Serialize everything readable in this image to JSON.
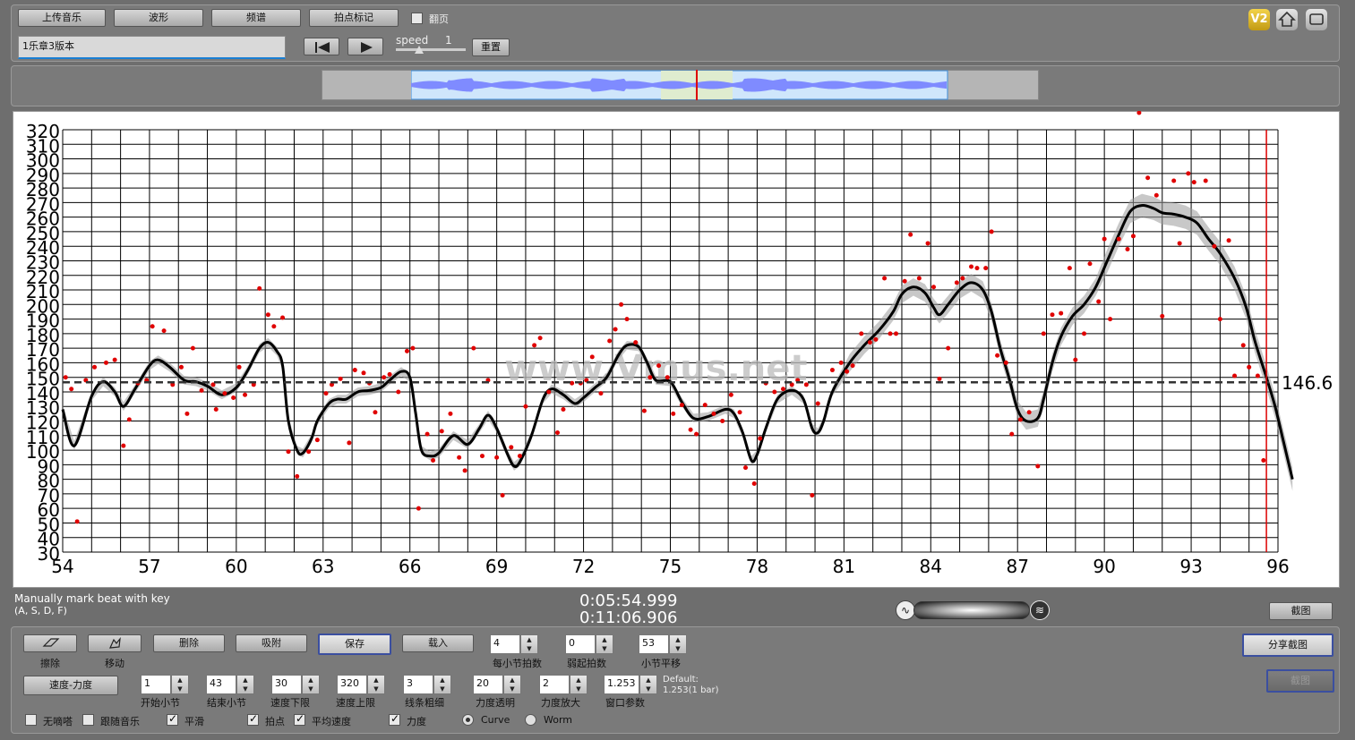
{
  "toolbar": {
    "upload": "上传音乐",
    "waveform": "波形",
    "spectrum": "频谱",
    "beat_mark": "拍点标记",
    "flip_page": "翻页",
    "speed_label": "speed",
    "speed_value": "1",
    "reset": "重置",
    "file_value": "1乐章3版本"
  },
  "top_right": {
    "badge": "V2"
  },
  "chart_data": {
    "type": "line",
    "x_ticks": [
      54,
      57,
      60,
      63,
      66,
      69,
      72,
      75,
      78,
      81,
      84,
      87,
      90,
      93,
      96
    ],
    "y_ticks": [
      30,
      40,
      50,
      60,
      70,
      80,
      90,
      100,
      110,
      120,
      130,
      140,
      150,
      160,
      170,
      180,
      190,
      200,
      210,
      220,
      230,
      240,
      250,
      260,
      270,
      280,
      290,
      300,
      310,
      320
    ],
    "xlim": [
      54,
      96
    ],
    "ylim": [
      30,
      320
    ],
    "average_value": 146.6,
    "average_label": "146.6",
    "playhead_x": 95.6,
    "watermark": "www.Vmus.net",
    "curve": [
      [
        54,
        128
      ],
      [
        54.4,
        103
      ],
      [
        55,
        137
      ],
      [
        55.4,
        147
      ],
      [
        55.8,
        140
      ],
      [
        56.1,
        130
      ],
      [
        56.5,
        142
      ],
      [
        57,
        158
      ],
      [
        57.3,
        162
      ],
      [
        57.7,
        157
      ],
      [
        58.2,
        148
      ],
      [
        58.6,
        147
      ],
      [
        59,
        144
      ],
      [
        59.5,
        138
      ],
      [
        60,
        143
      ],
      [
        60.4,
        155
      ],
      [
        60.8,
        170
      ],
      [
        61.1,
        174
      ],
      [
        61.4,
        168
      ],
      [
        61.6,
        158
      ],
      [
        61.8,
        120
      ],
      [
        62.1,
        100
      ],
      [
        62.3,
        98
      ],
      [
        62.6,
        108
      ],
      [
        62.8,
        120
      ],
      [
        63.2,
        132
      ],
      [
        63.5,
        135
      ],
      [
        63.8,
        135
      ],
      [
        64.2,
        140
      ],
      [
        64.6,
        141
      ],
      [
        65,
        143
      ],
      [
        65.3,
        148
      ],
      [
        65.7,
        154
      ],
      [
        66,
        150
      ],
      [
        66.2,
        125
      ],
      [
        66.4,
        100
      ],
      [
        66.7,
        96
      ],
      [
        67,
        98
      ],
      [
        67.5,
        110
      ],
      [
        68,
        104
      ],
      [
        68.4,
        115
      ],
      [
        68.7,
        124
      ],
      [
        69,
        115
      ],
      [
        69.4,
        96
      ],
      [
        69.6,
        89
      ],
      [
        69.8,
        92
      ],
      [
        70.2,
        110
      ],
      [
        70.6,
        135
      ],
      [
        70.9,
        142
      ],
      [
        71.3,
        138
      ],
      [
        71.7,
        132
      ],
      [
        72,
        136
      ],
      [
        72.4,
        143
      ],
      [
        72.8,
        150
      ],
      [
        73.2,
        165
      ],
      [
        73.5,
        172
      ],
      [
        73.9,
        171
      ],
      [
        74.2,
        160
      ],
      [
        74.5,
        148
      ],
      [
        75,
        147
      ],
      [
        75.4,
        133
      ],
      [
        75.8,
        122
      ],
      [
        76.3,
        123
      ],
      [
        76.9,
        128
      ],
      [
        77.2,
        125
      ],
      [
        77.5,
        112
      ],
      [
        77.8,
        93
      ],
      [
        78,
        97
      ],
      [
        78.3,
        115
      ],
      [
        78.7,
        135
      ],
      [
        79.2,
        141
      ],
      [
        79.6,
        135
      ],
      [
        79.9,
        115
      ],
      [
        80.1,
        112
      ],
      [
        80.3,
        120
      ],
      [
        80.6,
        140
      ],
      [
        81.2,
        160
      ],
      [
        81.7,
        172
      ],
      [
        82.2,
        182
      ],
      [
        82.7,
        195
      ],
      [
        83,
        207
      ],
      [
        83.4,
        212
      ],
      [
        83.8,
        208
      ],
      [
        84.1,
        198
      ],
      [
        84.3,
        193
      ],
      [
        84.6,
        200
      ],
      [
        85,
        210
      ],
      [
        85.4,
        215
      ],
      [
        85.8,
        210
      ],
      [
        86.1,
        195
      ],
      [
        86.4,
        170
      ],
      [
        86.7,
        150
      ],
      [
        87,
        128
      ],
      [
        87.3,
        120
      ],
      [
        87.7,
        122
      ],
      [
        87.9,
        135
      ],
      [
        88.2,
        160
      ],
      [
        88.5,
        178
      ],
      [
        88.9,
        192
      ],
      [
        89.3,
        200
      ],
      [
        89.7,
        212
      ],
      [
        90.1,
        230
      ],
      [
        90.5,
        248
      ],
      [
        90.9,
        264
      ],
      [
        91.3,
        268
      ],
      [
        91.7,
        266
      ],
      [
        92,
        263
      ],
      [
        92.4,
        262
      ],
      [
        92.8,
        260
      ],
      [
        93.2,
        256
      ],
      [
        93.6,
        245
      ],
      [
        94,
        235
      ],
      [
        94.5,
        218
      ],
      [
        94.9,
        198
      ],
      [
        95.2,
        175
      ],
      [
        95.6,
        150
      ],
      [
        95.9,
        130
      ],
      [
        96.2,
        105
      ],
      [
        96.5,
        80
      ]
    ],
    "points": [
      [
        54.1,
        150
      ],
      [
        54.3,
        142
      ],
      [
        54.5,
        51
      ],
      [
        54.8,
        148
      ],
      [
        55.1,
        157
      ],
      [
        55.5,
        160
      ],
      [
        55.8,
        162
      ],
      [
        56.1,
        103
      ],
      [
        56.3,
        121
      ],
      [
        56.6,
        146
      ],
      [
        56.9,
        148
      ],
      [
        57.1,
        185
      ],
      [
        57.5,
        182
      ],
      [
        57.8,
        145
      ],
      [
        58.1,
        157
      ],
      [
        58.3,
        125
      ],
      [
        58.5,
        170
      ],
      [
        58.8,
        141
      ],
      [
        59.2,
        145
      ],
      [
        59.3,
        128
      ],
      [
        59.6,
        139
      ],
      [
        59.9,
        136
      ],
      [
        60.1,
        157
      ],
      [
        60.3,
        138
      ],
      [
        60.6,
        145
      ],
      [
        60.8,
        211
      ],
      [
        61.1,
        193
      ],
      [
        61.3,
        185
      ],
      [
        61.6,
        191
      ],
      [
        61.8,
        99
      ],
      [
        62.1,
        82
      ],
      [
        62.5,
        99
      ],
      [
        62.8,
        107
      ],
      [
        63.1,
        139
      ],
      [
        63.3,
        145
      ],
      [
        63.6,
        149
      ],
      [
        63.9,
        105
      ],
      [
        64.1,
        155
      ],
      [
        64.4,
        153
      ],
      [
        64.6,
        146
      ],
      [
        64.8,
        126
      ],
      [
        65.1,
        150
      ],
      [
        65.3,
        152
      ],
      [
        65.6,
        140
      ],
      [
        65.9,
        168
      ],
      [
        66.1,
        170
      ],
      [
        66.3,
        60
      ],
      [
        66.6,
        111
      ],
      [
        66.8,
        93
      ],
      [
        67.1,
        113
      ],
      [
        67.4,
        125
      ],
      [
        67.7,
        95
      ],
      [
        67.9,
        86
      ],
      [
        68.2,
        170
      ],
      [
        68.5,
        96
      ],
      [
        68.7,
        148
      ],
      [
        69,
        95
      ],
      [
        69.2,
        69
      ],
      [
        69.5,
        102
      ],
      [
        69.8,
        96
      ],
      [
        70,
        130
      ],
      [
        70.3,
        172
      ],
      [
        70.5,
        177
      ],
      [
        70.8,
        140
      ],
      [
        71.1,
        112
      ],
      [
        71.3,
        128
      ],
      [
        71.6,
        146
      ],
      [
        71.9,
        146
      ],
      [
        72.1,
        148
      ],
      [
        72.3,
        164
      ],
      [
        72.6,
        139
      ],
      [
        72.9,
        175
      ],
      [
        73.1,
        183
      ],
      [
        73.3,
        200
      ],
      [
        73.5,
        190
      ],
      [
        73.8,
        174
      ],
      [
        74.1,
        127
      ],
      [
        74.3,
        150
      ],
      [
        74.6,
        158
      ],
      [
        74.9,
        150
      ],
      [
        75.1,
        125
      ],
      [
        75.4,
        131
      ],
      [
        75.7,
        114
      ],
      [
        75.9,
        111
      ],
      [
        76.2,
        131
      ],
      [
        76.5,
        125
      ],
      [
        76.8,
        120
      ],
      [
        77.1,
        138
      ],
      [
        77.4,
        126
      ],
      [
        77.6,
        88
      ],
      [
        77.9,
        77
      ],
      [
        78.1,
        108
      ],
      [
        78.3,
        146
      ],
      [
        78.6,
        140
      ],
      [
        78.9,
        142
      ],
      [
        79.2,
        145
      ],
      [
        79.4,
        148
      ],
      [
        79.7,
        145
      ],
      [
        79.9,
        69
      ],
      [
        80.1,
        132
      ],
      [
        80.6,
        155
      ],
      [
        80.9,
        160
      ],
      [
        81.1,
        154
      ],
      [
        81.3,
        158
      ],
      [
        81.6,
        180
      ],
      [
        81.9,
        174
      ],
      [
        82.1,
        176
      ],
      [
        82.4,
        218
      ],
      [
        82.6,
        180
      ],
      [
        82.8,
        180
      ],
      [
        83.1,
        216
      ],
      [
        83.3,
        248
      ],
      [
        83.6,
        218
      ],
      [
        83.9,
        242
      ],
      [
        84.1,
        212
      ],
      [
        84.3,
        149
      ],
      [
        84.6,
        170
      ],
      [
        84.9,
        215
      ],
      [
        85.1,
        218
      ],
      [
        85.4,
        226
      ],
      [
        85.6,
        225
      ],
      [
        85.9,
        225
      ],
      [
        86.1,
        250
      ],
      [
        86.3,
        165
      ],
      [
        86.6,
        160
      ],
      [
        86.8,
        111
      ],
      [
        87.1,
        121
      ],
      [
        87.4,
        126
      ],
      [
        87.7,
        89
      ],
      [
        87.9,
        180
      ],
      [
        88.2,
        193
      ],
      [
        88.5,
        194
      ],
      [
        88.8,
        225
      ],
      [
        89,
        162
      ],
      [
        89.3,
        180
      ],
      [
        89.5,
        228
      ],
      [
        89.8,
        202
      ],
      [
        90,
        245
      ],
      [
        90.2,
        190
      ],
      [
        90.5,
        245
      ],
      [
        90.8,
        238
      ],
      [
        91,
        247
      ],
      [
        91.2,
        337
      ],
      [
        91.5,
        287
      ],
      [
        91.8,
        275
      ],
      [
        92,
        192
      ],
      [
        92.4,
        285
      ],
      [
        92.6,
        242
      ],
      [
        92.9,
        290
      ],
      [
        93.1,
        284
      ],
      [
        93.5,
        285
      ],
      [
        93.8,
        240
      ],
      [
        94,
        190
      ],
      [
        94.3,
        244
      ],
      [
        94.5,
        151
      ],
      [
        94.8,
        172
      ],
      [
        95,
        157
      ],
      [
        95.3,
        151
      ],
      [
        95.5,
        93
      ]
    ]
  },
  "status": {
    "hint_line1": "Manually mark beat with key",
    "hint_line2": "(A, S, D, F)",
    "time_current": "0:05:54.999",
    "time_total": "0:11:06.906",
    "screenshot_btn": "截图"
  },
  "controls": {
    "erase": "擦除",
    "move": "移动",
    "delete": "删除",
    "snap": "吸附",
    "save": "保存",
    "load": "载入",
    "beats_per_bar_label": "每小节拍数",
    "beats_per_bar": "4",
    "pickup_label": "弱起拍数",
    "pickup": "0",
    "bar_shift_label": "小节平移",
    "bar_shift": "53",
    "share_btn": "分享截图",
    "dark_btn": "截图",
    "tempo_dynamics": "速度-力度",
    "start_bar_label": "开始小节",
    "start_bar": "1",
    "end_bar_label": "结束小节",
    "end_bar": "43",
    "tempo_low_label": "速度下限",
    "tempo_low": "30",
    "tempo_high_label": "速度上限",
    "tempo_high": "320",
    "line_width_label": "线条粗细",
    "line_width": "3",
    "dyn_opacity_label": "力度透明",
    "dyn_opacity": "20",
    "dyn_zoom_label": "力度放大",
    "dyn_zoom": "2",
    "window_label": "窗口参数",
    "window": "1.253",
    "default_line1": "Default:",
    "default_line2": "1.253(1 bar)",
    "cb_no_click": "无嘀嗒",
    "cb_follow": "跟随音乐",
    "cb_smooth": "平滑",
    "cb_beats": "拍点",
    "cb_avg": "平均速度",
    "cb_dyn": "力度",
    "radio_curve": "Curve",
    "radio_worm": "Worm"
  }
}
